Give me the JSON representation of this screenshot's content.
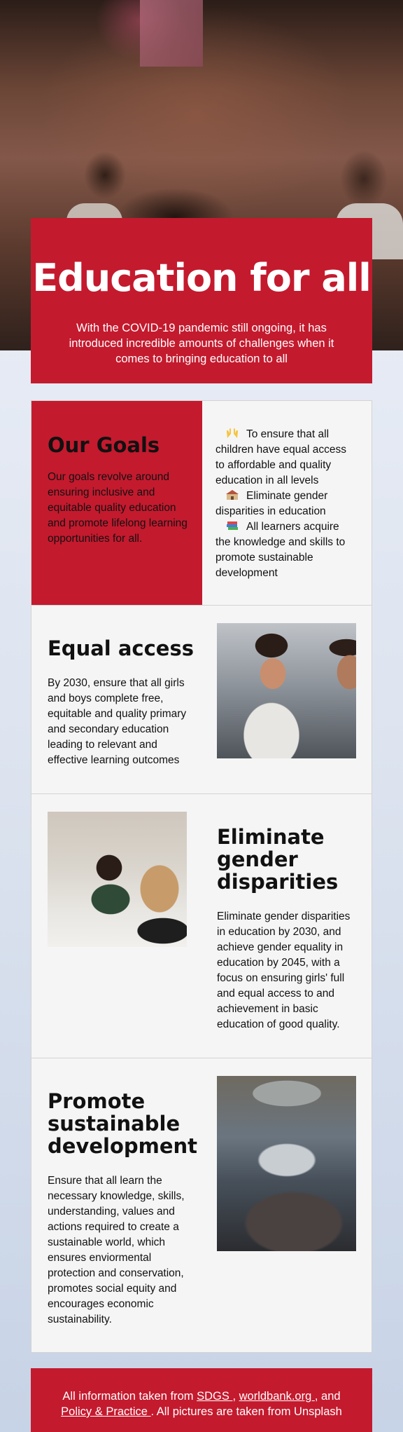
{
  "hero": {
    "title": "Education for all",
    "subtitle": "With the COVID-19 pandemic still ongoing, it has introduced incredible amounts of challenges when it comes to bringing education to all"
  },
  "goals": {
    "title": "Our Goals",
    "text": "Our goals revolve around ensuring inclusive and equitable quality education and promote lifelong learning opportunities for all.",
    "items": [
      {
        "icon": "raised-hands-icon",
        "label": "To ensure that all children have equal access to affordable and quality education in all levels"
      },
      {
        "icon": "school-icon",
        "label": "Eliminate gender disparities in education"
      },
      {
        "icon": "books-icon",
        "label": "All learners acquire the knowledge and skills to promote sustainable development"
      }
    ]
  },
  "equal_access": {
    "title": "Equal access",
    "text": "By 2030, ensure that all girls and boys complete free, equitable and quality primary and secondary education leading to relevant and effective learning outcomes"
  },
  "gender": {
    "title": "Eliminate gender disparities",
    "text": "Eliminate gender disparities in education by 2030, and achieve gender equality in education by 2045, with a focus on ensuring girls' full and equal access to and achievement in basic education of good quality."
  },
  "sustainable": {
    "title": "Promote sustainable development",
    "text": "Ensure that all learn the necessary knowledge, skills, understanding, values and actions required to create a sustainable world, which ensures enviormental protection and conservation, promotes social equity and encourages economic sustainability."
  },
  "footer": {
    "prefix": "All information taken from ",
    "link1": "SDGS ",
    "sep1": ", ",
    "link2": "worldbank.org ",
    "sep2": ", and ",
    "link3": "Policy & Practice ",
    "suffix": ". All pictures are taken from Unsplash"
  },
  "colors": {
    "accent": "#c41a2e",
    "panel": "#f5f5f5"
  }
}
